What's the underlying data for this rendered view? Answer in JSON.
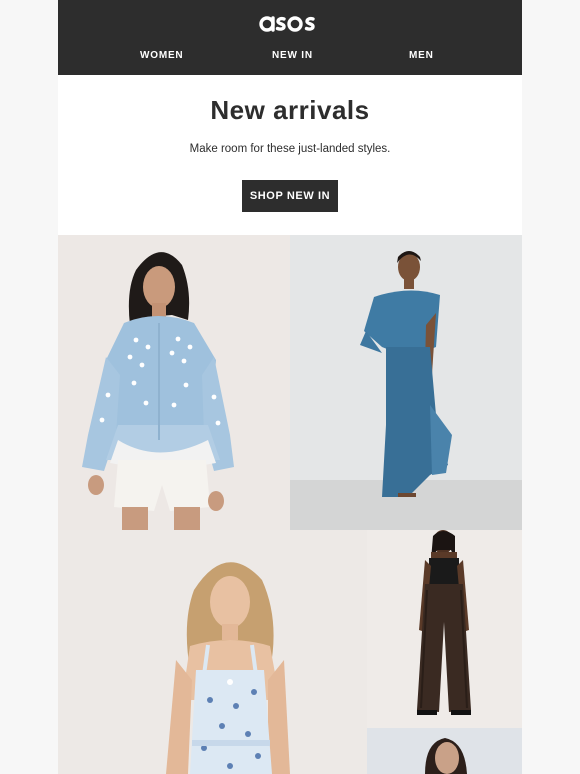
{
  "brand": {
    "logo_text": "asos"
  },
  "nav": {
    "women": "WOMEN",
    "new_in": "NEW IN",
    "men": "MEN"
  },
  "hero": {
    "title": "New arrivals",
    "subtitle": "Make room for these just-landed styles.",
    "cta_label": "SHOP NEW IN"
  },
  "colors": {
    "header_bg": "#2d2d2d",
    "button_bg": "#2d2d2d",
    "page_bg": "#f7f7f7",
    "text": "#2d2d2d"
  }
}
